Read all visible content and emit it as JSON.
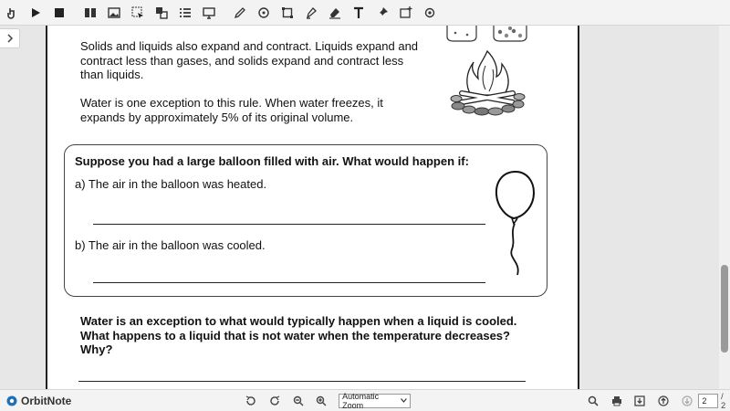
{
  "toolbar": {
    "buttons": [
      "hand-tool",
      "play",
      "stop",
      "book",
      "image",
      "select",
      "translate",
      "list",
      "screen",
      "pen",
      "shape",
      "crop",
      "marker",
      "eraser",
      "text",
      "pin",
      "add-image",
      "settings"
    ]
  },
  "document": {
    "para1": "Solids and liquids also expand and contract. Liquids expand and contract less than gases, and solids expand and contract less than liquids.",
    "para2": "Water is one exception to this rule. When water freezes, it expands by approximately 5% of its original volume.",
    "question_title": "Suppose you had a large balloon filled with air. What would happen if:",
    "question_a": "a) The air in the balloon was heated.",
    "question_b": "b) The air in the balloon was cooled.",
    "question_water": "Water is an exception to what would typically happen when a liquid is cooled. What happens to a liquid that is not water when the temperature decreases? Why?"
  },
  "bottombar": {
    "logo_text": "OrbitNote",
    "zoom_value": "Automatic Zoom",
    "page_current": "2",
    "page_total": "/ 2"
  }
}
